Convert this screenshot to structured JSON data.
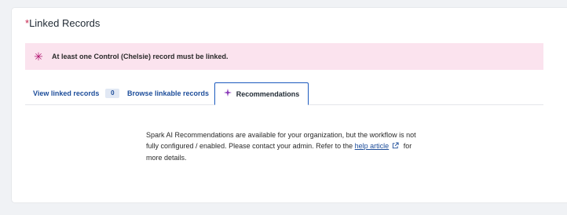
{
  "section": {
    "required_marker": "*",
    "title": "Linked Records"
  },
  "alert": {
    "icon": "asterisk-icon",
    "message": "At least one Control (Chelsie) record must be linked.",
    "background": "#fbe3ee",
    "icon_color": "#b1126f"
  },
  "tabs": {
    "view_linked": {
      "label": "View linked records",
      "count": "0"
    },
    "browse": {
      "label": "Browse linkable records"
    },
    "recommendations": {
      "label": "Recommendations",
      "icon": "sparkle-icon",
      "active": true
    }
  },
  "recommendations_panel": {
    "text_before_link": "Spark AI Recommendations are available for your organization, but the workflow is not fully configured / enabled. Please contact your admin. Refer to the ",
    "link_text": "help article",
    "text_after_link": " for more details."
  },
  "colors": {
    "accent": "#1d4d9a",
    "tab_border": "#1d5bbf",
    "required": "#c7254e"
  }
}
